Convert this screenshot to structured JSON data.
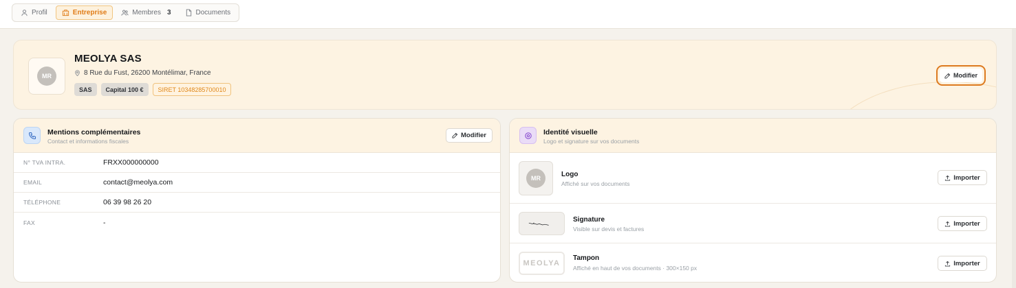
{
  "tabs": [
    {
      "label": "Profil",
      "icon": "user-icon",
      "active": false
    },
    {
      "label": "Entreprise",
      "icon": "building-icon",
      "active": true
    },
    {
      "label": "Membres",
      "icon": "users-icon",
      "count": "3",
      "active": false
    },
    {
      "label": "Documents",
      "icon": "document-icon",
      "active": false
    }
  ],
  "company": {
    "initials": "MR",
    "name": "MEOLYA SAS",
    "address": "8 Rue du Fust, 26200 Montélimar, France",
    "badges": [
      "SAS",
      "Capital 100 €",
      "SIRET 10348285700010"
    ],
    "modify_label": "Modifier"
  },
  "mentions": {
    "title": "Mentions complémentaires",
    "subtitle": "Contact et informations fiscales",
    "modify_label": "Modifier",
    "rows": [
      {
        "label": "N° TVA INTRA.",
        "value": "FRXX000000000"
      },
      {
        "label": "EMAIL",
        "value": "contact@meolya.com"
      },
      {
        "label": "TÉLÉPHONE",
        "value": "06 39 98 26 20"
      },
      {
        "label": "FAX",
        "value": "-"
      }
    ]
  },
  "visual": {
    "title": "Identité visuelle",
    "subtitle": "Logo et signature sur vos documents",
    "items": [
      {
        "title": "Logo",
        "subtitle": "Affiché sur vos documents",
        "thumb": "MR",
        "button": "Importer"
      },
      {
        "title": "Signature",
        "subtitle": "Visible sur devis et factures",
        "button": "Importer"
      },
      {
        "title": "Tampon",
        "subtitle": "Affiché en haut de vos documents · 300×150 px",
        "thumb": "MEOLYA",
        "button": "Importer"
      }
    ]
  },
  "colors": {
    "accent": "#e07c18",
    "header_bg": "#fdf3e2",
    "page_bg": "#f5f2ec"
  }
}
